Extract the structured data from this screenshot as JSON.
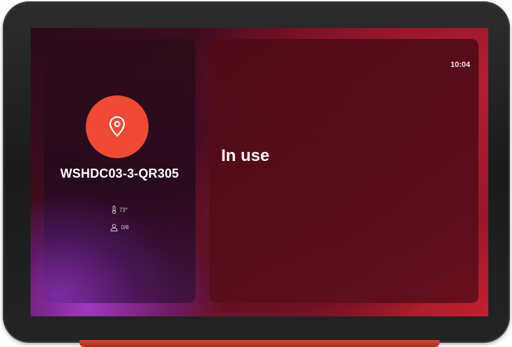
{
  "room": {
    "name": "WSHDC03-3-QR305",
    "temperature": "73°",
    "occupancy": "0/8"
  },
  "status": {
    "label": "In use"
  },
  "clock": {
    "time": "10:04"
  },
  "colors": {
    "accent": "#ef4a36",
    "in_use_background": "#8a1628",
    "bezel": "#1f1f20"
  },
  "icons": {
    "location": "location-pin-icon",
    "temperature": "thermometer-icon",
    "occupancy": "person-icon"
  }
}
